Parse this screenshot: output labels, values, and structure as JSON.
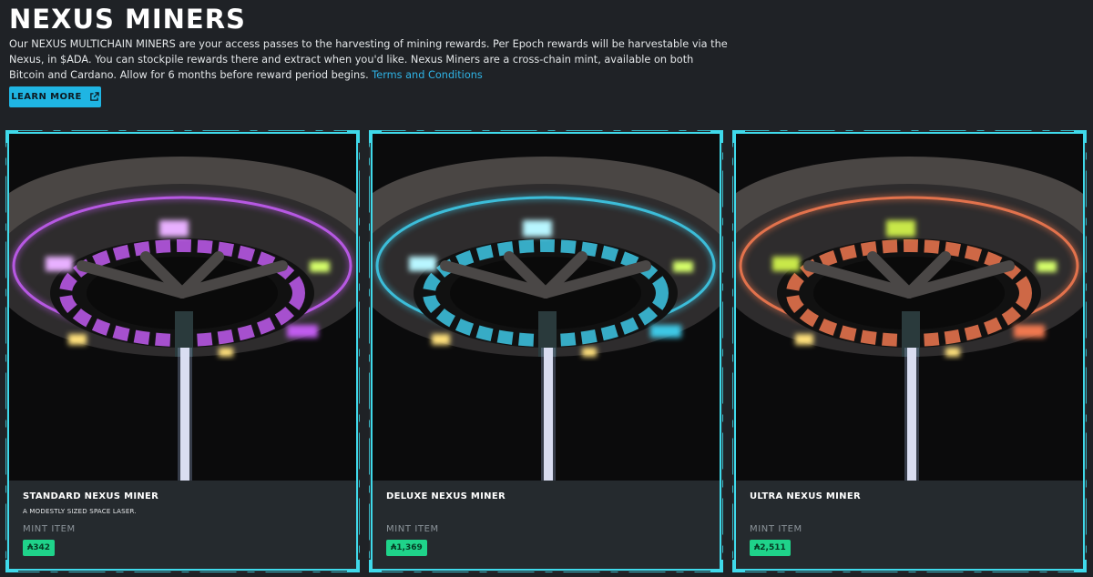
{
  "header": {
    "title": "NEXUS MINERS",
    "description": "Our NEXUS MULTICHAIN MINERS are your access passes to the harvesting of mining rewards. Per Epoch rewards will be harvestable via the Nexus, in $ADA. You can stockpile rewards there and extract when you'd like. Nexus Miners are a cross-chain mint, available on both Bitcoin and Cardano. Allow for 6 months before reward period begins.",
    "terms_link": "Terms and Conditions",
    "learn_more_label": "LEARN MORE"
  },
  "colors": {
    "accent": "#1fb5e3",
    "frame": "#3fd9ea",
    "price_badge": "#1fd38a"
  },
  "cards": [
    {
      "name": "Standard Nexus Miner",
      "subtitle": "A modestly sized space laser.",
      "mint_label": "MINT ITEM",
      "price": "₳342",
      "glow_color": "#c15cf0",
      "accent_color": "#e8b0ff"
    },
    {
      "name": "Deluxe Nexus Miner",
      "subtitle": "",
      "mint_label": "MINT ITEM",
      "price": "₳1,369",
      "glow_color": "#3ec8e6",
      "accent_color": "#b8f6ff"
    },
    {
      "name": "Ultra Nexus Miner",
      "subtitle": "",
      "mint_label": "MINT ITEM",
      "price": "₳2,511",
      "glow_color": "#f07850",
      "accent_color": "#c8e84a"
    }
  ]
}
